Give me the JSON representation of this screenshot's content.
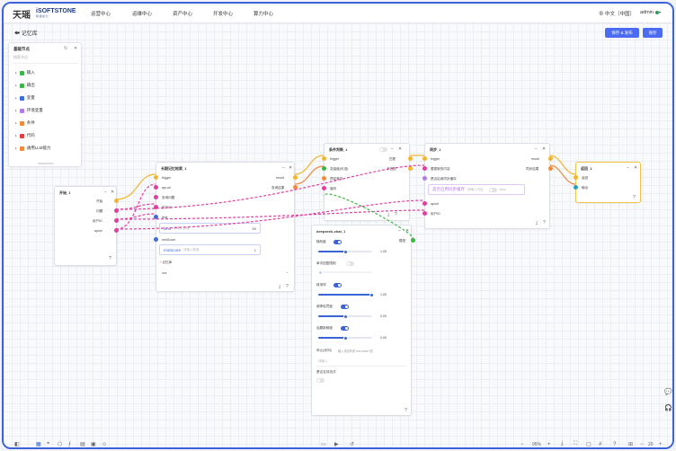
{
  "header": {
    "logo_main": "天瑶",
    "logo_brand": "iSOFTSTONE",
    "logo_sub": "软通动力",
    "nav": [
      "运营中心",
      "运维中心",
      "资产中心",
      "开发中心",
      "算力中心"
    ],
    "lang": "中文（中国）",
    "user": "admin"
  },
  "toolbar": {
    "breadcrumb": "记忆库",
    "save_publish": "保存 & 发布",
    "save": "保存"
  },
  "panel": {
    "title": "基础节点",
    "search_placeholder": "搜索节点",
    "categories": [
      {
        "label": "输入",
        "color": "#3ab845"
      },
      {
        "label": "输出",
        "color": "#3ab845"
      },
      {
        "label": "变量",
        "color": "#3a6be0"
      },
      {
        "label": "环境变量",
        "color": "#b17be8"
      },
      {
        "label": "条件",
        "color": "#f08a3a"
      },
      {
        "label": "代码",
        "color": "#e53d3d"
      },
      {
        "label": "通用LLM能力",
        "color": "#f08a3a"
      }
    ]
  },
  "nodes": {
    "start": {
      "title": "开始_1",
      "ports": [
        "开始",
        "问题",
        "用户ID",
        "apiurl"
      ]
    },
    "memory": {
      "title": "长期记忆检索_1",
      "inputs": [
        "trigger",
        "api-url",
        "查询问题",
        "用户ID",
        "limit"
      ],
      "outputs": [
        "result",
        "查询结果"
      ],
      "limit_label": "limit",
      "limit_ph": "请输入数值",
      "limit_val": "50",
      "min_label": "minScore",
      "min_ph": "请输入数值",
      "min_val": "1",
      "memlib_label": "记忆库",
      "memlib_val": "xxx"
    },
    "cond": {
      "title": "条件判断_1",
      "inputs": [
        "trigger",
        "变量值(可选)",
        "预定条件",
        "值判"
      ],
      "outputs": [
        "匹配",
        "不匹配"
      ]
    },
    "sync": {
      "title": "同步_1",
      "inputs": [
        "trigger",
        "要更新的内容",
        "是否启用同步缓存"
      ],
      "outputs": [
        "result",
        "同步结果"
      ],
      "cache_label": "是否启用同步缓存",
      "cache_hint": "请输入内容",
      "cache_val": "false",
      "extra_inputs": [
        "apiurl",
        "用户ID"
      ]
    },
    "ret": {
      "title": "返回_1",
      "ports": [
        "返回",
        "输出"
      ]
    },
    "llm": {
      "title": "deepseek-chat_1",
      "out_label": "模型",
      "params": [
        {
          "label": "随机度",
          "value": "1.00",
          "enabled": true,
          "level": 0.5
        },
        {
          "label": "单次回复限制",
          "value": "",
          "enabled": false,
          "level": 0.04
        },
        {
          "label": "核采样",
          "value": "1.00",
          "enabled": true,
          "level": 1.0
        },
        {
          "label": "频率惩罚度",
          "value": "0.00",
          "enabled": true,
          "level": 0.5
        },
        {
          "label": "话题新鲜度",
          "value": "0.00",
          "enabled": true,
          "level": 0.5
        }
      ],
      "stop_label": "停止(序列)",
      "stop_hint": "输入并回车成\"min-token\"值",
      "stop_ph": "请输入",
      "stream_label": "是否支持流式"
    }
  },
  "bottombar": {
    "zoom": "95%",
    "page_size": "20"
  }
}
